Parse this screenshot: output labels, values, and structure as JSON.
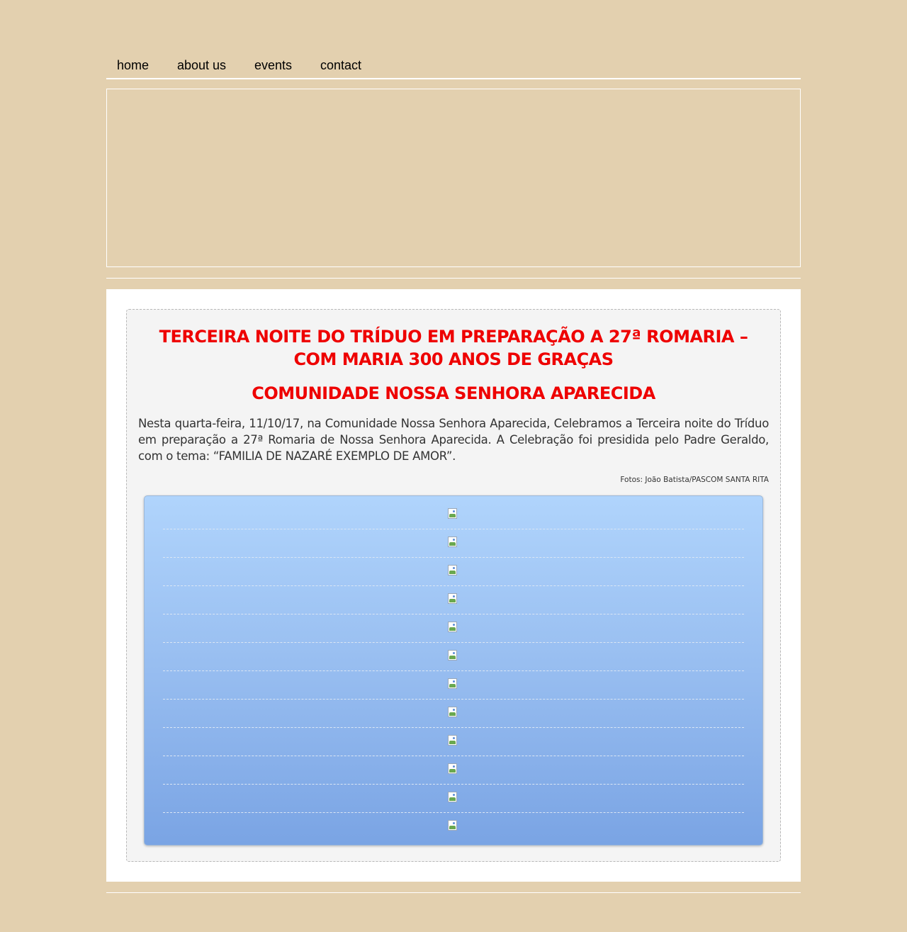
{
  "nav": {
    "items": [
      {
        "label": "home"
      },
      {
        "label": "about us"
      },
      {
        "label": "events"
      },
      {
        "label": "contact"
      }
    ]
  },
  "post": {
    "title": "TERCEIRA NOITE DO TRÍDUO EM PREPARAÇÃO A 27ª ROMARIA – COM MARIA 300 ANOS DE GRAÇAS",
    "subtitle": "COMUNIDADE NOSSA SENHORA APARECIDA",
    "body": "Nesta quarta-feira, 11/10/17, na Comunidade Nossa Senhora Aparecida, Celebramos a Terceira noite do Tríduo em preparação a 27ª Romaria de Nossa Senhora Aparecida. A Celebração foi presidida pelo Padre Geraldo, com o tema: “FAMILIA DE NAZARÉ EXEMPLO DE AMOR”.",
    "credit": "Fotos: João Batista/PASCOM SANTA RITA"
  },
  "gallery": {
    "photo_count": 12,
    "icon": "broken-image-icon"
  }
}
